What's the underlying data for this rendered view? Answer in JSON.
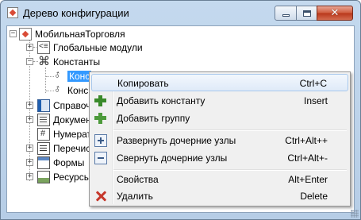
{
  "window": {
    "title": "Дерево конфигурации",
    "icon": "config-tree-icon"
  },
  "tree": {
    "root": {
      "label": "МобильнаяТорговля",
      "icon": "config-root-icon",
      "expanded": true
    },
    "nodes": [
      {
        "label": "Глобальные модули",
        "icon": "module-icon",
        "expander": "+"
      },
      {
        "label": "Константы",
        "icon": "constants-icon",
        "expander": "−"
      },
      {
        "label": "Конс",
        "icon": "constant-item-icon",
        "selected": true
      },
      {
        "label": "Конс",
        "icon": "constant-item-icon"
      },
      {
        "label": "Справоч",
        "icon": "catalog-icon",
        "expander": "+"
      },
      {
        "label": "Докумен",
        "icon": "document-icon",
        "expander": "+"
      },
      {
        "label": "Нумерат",
        "icon": "numerator-icon"
      },
      {
        "label": "Перечис",
        "icon": "enum-icon",
        "expander": "+"
      },
      {
        "label": "Формы",
        "icon": "form-icon",
        "expander": "+"
      },
      {
        "label": "Ресурсы",
        "icon": "resources-icon",
        "expander": "+"
      }
    ]
  },
  "context_menu": {
    "items": [
      {
        "label": "Копировать",
        "shortcut": "Ctrl+C",
        "icon": "",
        "highlighted": true
      },
      {
        "label": "Добавить константу",
        "shortcut": "Insert",
        "icon": "add-constant-icon"
      },
      {
        "label": "Добавить группу",
        "shortcut": "",
        "icon": "add-group-icon"
      },
      {
        "label": "Развернуть дочерние узлы",
        "shortcut": "Ctrl+Alt++",
        "icon": "expand-children-icon"
      },
      {
        "label": "Свернуть дочерние узлы",
        "shortcut": "Ctrl+Alt+-",
        "icon": "collapse-children-icon"
      },
      {
        "label": "Свойства",
        "shortcut": "Alt+Enter",
        "icon": ""
      },
      {
        "label": "Удалить",
        "shortcut": "Delete",
        "icon": "delete-icon"
      }
    ]
  },
  "colors": {
    "selection": "#3399ff",
    "menu_highlight_border": "#a8c8ec",
    "close_button": "#c9452a",
    "titlebar": "#c4d9ee"
  }
}
